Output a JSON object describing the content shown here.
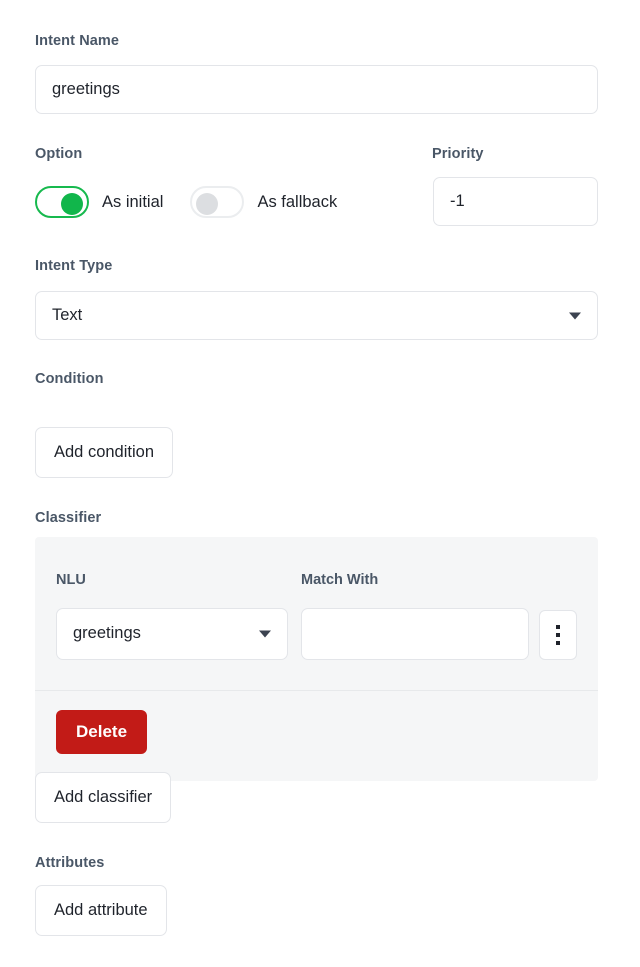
{
  "intent_name": {
    "label": "Intent Name",
    "value": "greetings"
  },
  "option": {
    "label": "Option",
    "as_initial_label": "As initial",
    "as_fallback_label": "As fallback",
    "as_initial_on": true,
    "as_fallback_on": false
  },
  "priority": {
    "label": "Priority",
    "value": "-1"
  },
  "intent_type": {
    "label": "Intent Type",
    "value": "Text"
  },
  "condition": {
    "label": "Condition",
    "add_button": "Add condition"
  },
  "classifier": {
    "label": "Classifier",
    "nlu_label": "NLU",
    "nlu_value": "greetings",
    "match_with_label": "Match With",
    "match_with_value": "",
    "menu_icon": "kebab-menu-icon",
    "delete_button": "Delete",
    "add_button": "Add classifier"
  },
  "attributes": {
    "label": "Attributes",
    "add_button": "Add attribute"
  },
  "colors": {
    "toggle_on": "#11b64b",
    "toggle_off": "#dcdee1",
    "danger": "#c21b17",
    "label_text": "#4a5767",
    "panel_bg": "#f5f6f7",
    "border": "#e3e5e9"
  }
}
